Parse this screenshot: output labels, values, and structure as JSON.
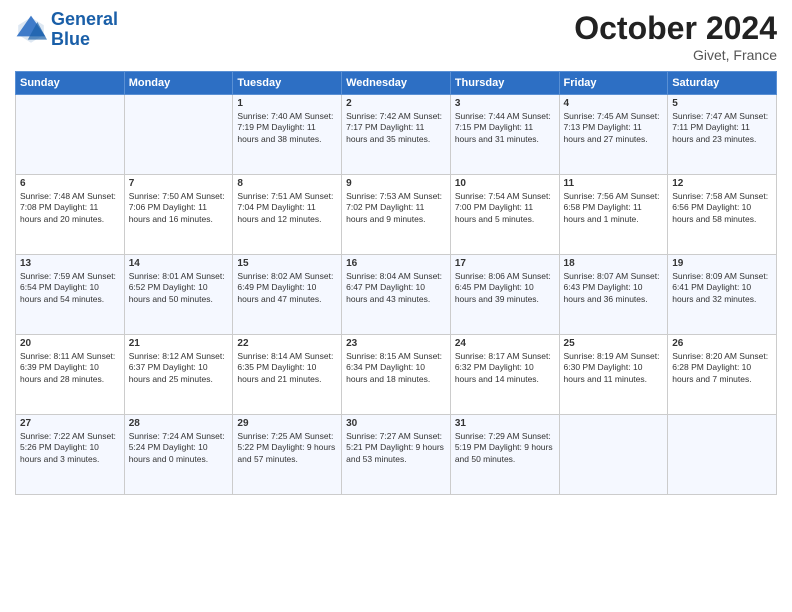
{
  "header": {
    "logo_line1": "General",
    "logo_line2": "Blue",
    "month_title": "October 2024",
    "location": "Givet, France"
  },
  "weekdays": [
    "Sunday",
    "Monday",
    "Tuesday",
    "Wednesday",
    "Thursday",
    "Friday",
    "Saturday"
  ],
  "weeks": [
    [
      {
        "day": "",
        "info": ""
      },
      {
        "day": "",
        "info": ""
      },
      {
        "day": "1",
        "info": "Sunrise: 7:40 AM\nSunset: 7:19 PM\nDaylight: 11 hours and 38 minutes."
      },
      {
        "day": "2",
        "info": "Sunrise: 7:42 AM\nSunset: 7:17 PM\nDaylight: 11 hours and 35 minutes."
      },
      {
        "day": "3",
        "info": "Sunrise: 7:44 AM\nSunset: 7:15 PM\nDaylight: 11 hours and 31 minutes."
      },
      {
        "day": "4",
        "info": "Sunrise: 7:45 AM\nSunset: 7:13 PM\nDaylight: 11 hours and 27 minutes."
      },
      {
        "day": "5",
        "info": "Sunrise: 7:47 AM\nSunset: 7:11 PM\nDaylight: 11 hours and 23 minutes."
      }
    ],
    [
      {
        "day": "6",
        "info": "Sunrise: 7:48 AM\nSunset: 7:08 PM\nDaylight: 11 hours and 20 minutes."
      },
      {
        "day": "7",
        "info": "Sunrise: 7:50 AM\nSunset: 7:06 PM\nDaylight: 11 hours and 16 minutes."
      },
      {
        "day": "8",
        "info": "Sunrise: 7:51 AM\nSunset: 7:04 PM\nDaylight: 11 hours and 12 minutes."
      },
      {
        "day": "9",
        "info": "Sunrise: 7:53 AM\nSunset: 7:02 PM\nDaylight: 11 hours and 9 minutes."
      },
      {
        "day": "10",
        "info": "Sunrise: 7:54 AM\nSunset: 7:00 PM\nDaylight: 11 hours and 5 minutes."
      },
      {
        "day": "11",
        "info": "Sunrise: 7:56 AM\nSunset: 6:58 PM\nDaylight: 11 hours and 1 minute."
      },
      {
        "day": "12",
        "info": "Sunrise: 7:58 AM\nSunset: 6:56 PM\nDaylight: 10 hours and 58 minutes."
      }
    ],
    [
      {
        "day": "13",
        "info": "Sunrise: 7:59 AM\nSunset: 6:54 PM\nDaylight: 10 hours and 54 minutes."
      },
      {
        "day": "14",
        "info": "Sunrise: 8:01 AM\nSunset: 6:52 PM\nDaylight: 10 hours and 50 minutes."
      },
      {
        "day": "15",
        "info": "Sunrise: 8:02 AM\nSunset: 6:49 PM\nDaylight: 10 hours and 47 minutes."
      },
      {
        "day": "16",
        "info": "Sunrise: 8:04 AM\nSunset: 6:47 PM\nDaylight: 10 hours and 43 minutes."
      },
      {
        "day": "17",
        "info": "Sunrise: 8:06 AM\nSunset: 6:45 PM\nDaylight: 10 hours and 39 minutes."
      },
      {
        "day": "18",
        "info": "Sunrise: 8:07 AM\nSunset: 6:43 PM\nDaylight: 10 hours and 36 minutes."
      },
      {
        "day": "19",
        "info": "Sunrise: 8:09 AM\nSunset: 6:41 PM\nDaylight: 10 hours and 32 minutes."
      }
    ],
    [
      {
        "day": "20",
        "info": "Sunrise: 8:11 AM\nSunset: 6:39 PM\nDaylight: 10 hours and 28 minutes."
      },
      {
        "day": "21",
        "info": "Sunrise: 8:12 AM\nSunset: 6:37 PM\nDaylight: 10 hours and 25 minutes."
      },
      {
        "day": "22",
        "info": "Sunrise: 8:14 AM\nSunset: 6:35 PM\nDaylight: 10 hours and 21 minutes."
      },
      {
        "day": "23",
        "info": "Sunrise: 8:15 AM\nSunset: 6:34 PM\nDaylight: 10 hours and 18 minutes."
      },
      {
        "day": "24",
        "info": "Sunrise: 8:17 AM\nSunset: 6:32 PM\nDaylight: 10 hours and 14 minutes."
      },
      {
        "day": "25",
        "info": "Sunrise: 8:19 AM\nSunset: 6:30 PM\nDaylight: 10 hours and 11 minutes."
      },
      {
        "day": "26",
        "info": "Sunrise: 8:20 AM\nSunset: 6:28 PM\nDaylight: 10 hours and 7 minutes."
      }
    ],
    [
      {
        "day": "27",
        "info": "Sunrise: 7:22 AM\nSunset: 5:26 PM\nDaylight: 10 hours and 3 minutes."
      },
      {
        "day": "28",
        "info": "Sunrise: 7:24 AM\nSunset: 5:24 PM\nDaylight: 10 hours and 0 minutes."
      },
      {
        "day": "29",
        "info": "Sunrise: 7:25 AM\nSunset: 5:22 PM\nDaylight: 9 hours and 57 minutes."
      },
      {
        "day": "30",
        "info": "Sunrise: 7:27 AM\nSunset: 5:21 PM\nDaylight: 9 hours and 53 minutes."
      },
      {
        "day": "31",
        "info": "Sunrise: 7:29 AM\nSunset: 5:19 PM\nDaylight: 9 hours and 50 minutes."
      },
      {
        "day": "",
        "info": ""
      },
      {
        "day": "",
        "info": ""
      }
    ]
  ]
}
